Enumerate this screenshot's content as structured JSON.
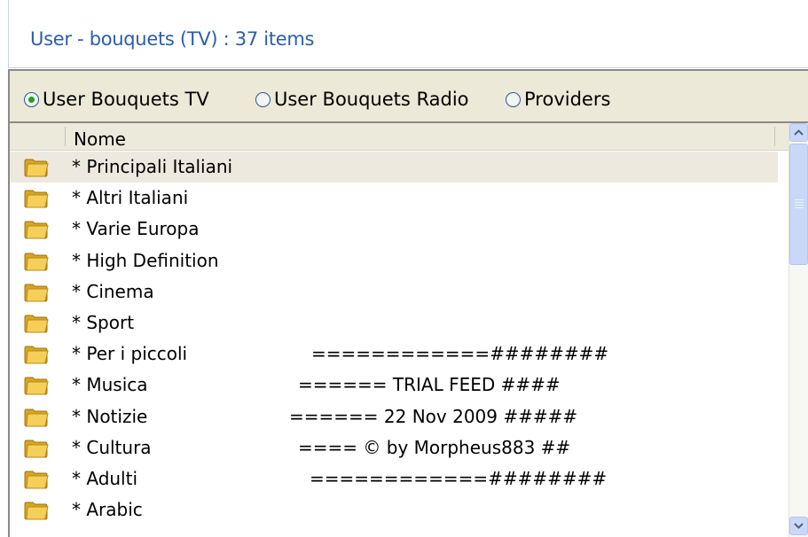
{
  "header": {
    "title": "User - bouquets (TV) : 37 items"
  },
  "radios": [
    {
      "label": "User Bouquets TV",
      "checked": true
    },
    {
      "label": "User Bouquets Radio",
      "checked": false
    },
    {
      "label": "Providers",
      "checked": false
    }
  ],
  "list": {
    "column_header": "Nome",
    "rows": [
      {
        "name": "* Principali Italiani",
        "extra": "",
        "selected": true
      },
      {
        "name": "* Altri Italiani",
        "extra": ""
      },
      {
        "name": "* Varie Europa",
        "extra": ""
      },
      {
        "name": "* High Definition",
        "extra": ""
      },
      {
        "name": "* Cinema",
        "extra": ""
      },
      {
        "name": "* Sport",
        "extra": ""
      },
      {
        "name": "* Per i piccoli",
        "extra": "============########"
      },
      {
        "name": "* Musica",
        "extra": "====== TRIAL FEED ####"
      },
      {
        "name": "* Notizie",
        "extra": "====== 22 Nov 2009 #####"
      },
      {
        "name": "* Cultura",
        "extra": "==== © by Morpheus883 ##"
      },
      {
        "name": "* Adulti",
        "extra": "============########"
      },
      {
        "name": "* Arabic",
        "extra": ""
      }
    ]
  },
  "icons": {
    "folder": "folder-icon",
    "scroll_up": "chevron-up-icon",
    "scroll_down": "chevron-down-icon"
  }
}
